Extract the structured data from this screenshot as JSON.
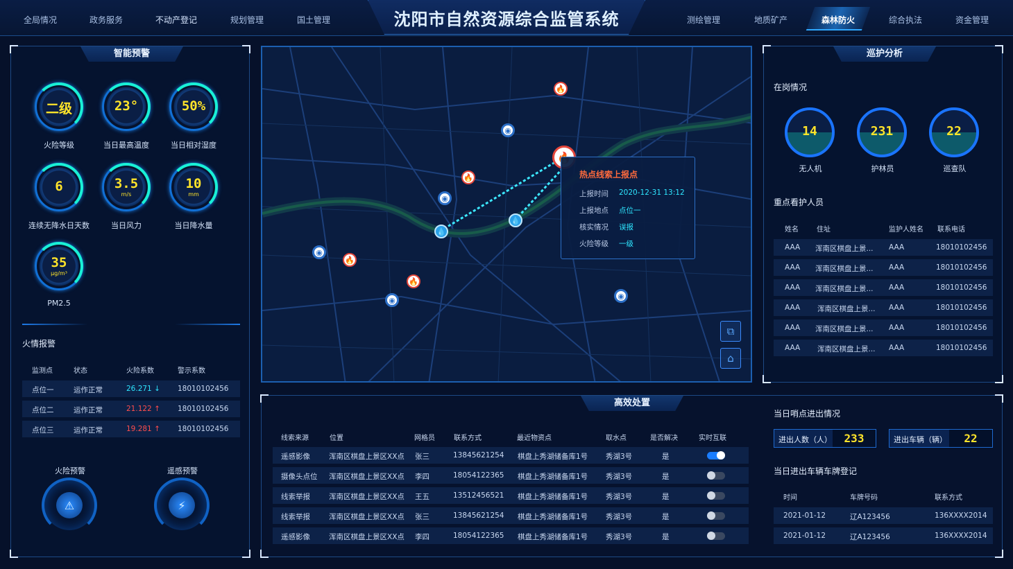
{
  "header": {
    "title": "沈阳市自然资源综合监管系统",
    "nav_left": [
      "全局情况",
      "政务服务",
      "不动产登记",
      "规划管理",
      "国土管理"
    ],
    "nav_right": [
      "测绘管理",
      "地质矿产",
      "森林防火",
      "综合执法",
      "资金管理"
    ],
    "active_nav": "森林防火"
  },
  "smart_warning": {
    "title": "智能预警",
    "gauges": [
      {
        "value": "二级",
        "unit": "",
        "label": "火险等级"
      },
      {
        "value": "23°",
        "unit": "",
        "label": "当日最高温度"
      },
      {
        "value": "50%",
        "unit": "",
        "label": "当日相对湿度"
      },
      {
        "value": "6",
        "unit": "",
        "label": "连续无降水日天数"
      },
      {
        "value": "3.5",
        "unit": "m/s",
        "label": "当日风力"
      },
      {
        "value": "10",
        "unit": "mm",
        "label": "当日降水量"
      },
      {
        "value": "35",
        "unit": "μg/m³",
        "label": "PM2.5"
      }
    ]
  },
  "fire_alarm": {
    "title": "火情报警",
    "headers": [
      "监测点",
      "状态",
      "火险系数",
      "警示系数"
    ],
    "rows": [
      {
        "point": "点位一",
        "status": "运作正常",
        "coef": "26.271 ↓",
        "warn": "18010102456",
        "color": "cyan"
      },
      {
        "point": "点位二",
        "status": "运作正常",
        "coef": "21.122 ↑",
        "warn": "18010102456",
        "color": "red"
      },
      {
        "point": "点位三",
        "status": "运作正常",
        "coef": "19.281 ↑",
        "warn": "18010102456",
        "color": "red"
      }
    ],
    "fire_warning_label": "火险预警",
    "remote_warning_label": "遥感预警"
  },
  "map": {
    "popup": {
      "title": "热点线索上报点",
      "time_label": "上报时间",
      "time": "2020-12-31 13:12",
      "location_label": "上报地点",
      "location": "点位一",
      "verify_label": "核实情况",
      "verify": "误报",
      "level_label": "火险等级",
      "level": "一级"
    }
  },
  "patrol": {
    "title": "巡护分析",
    "on_duty_title": "在岗情况",
    "on_duty": [
      {
        "value": "14",
        "label": "无人机"
      },
      {
        "value": "231",
        "label": "护林员"
      },
      {
        "value": "22",
        "label": "巡查队"
      }
    ],
    "key_persons_title": "重点看护人员",
    "headers": [
      "姓名",
      "住址",
      "监护人姓名",
      "联系电话"
    ],
    "rows": [
      {
        "name": "AAA",
        "addr": "浑南区棋盘上景...",
        "guardian": "AAA",
        "phone": "18010102456"
      },
      {
        "name": "AAA",
        "addr": "浑南区棋盘上景...",
        "guardian": "AAA",
        "phone": "18010102456"
      },
      {
        "name": "AAA",
        "addr": "浑南区棋盘上景...",
        "guardian": "AAA",
        "phone": "18010102456"
      },
      {
        "name": "AAA",
        "addr": "浑南区棋盘上景...",
        "guardian": "AAA",
        "phone": "18010102456"
      },
      {
        "name": "AAA",
        "addr": "浑南区棋盘上景...",
        "guardian": "AAA",
        "phone": "18010102456"
      },
      {
        "name": "AAA",
        "addr": "浑南区棋盘上景...",
        "guardian": "AAA",
        "phone": "18010102456"
      }
    ]
  },
  "disposal": {
    "title": "高效处置",
    "headers": [
      "线索来源",
      "位置",
      "网格员",
      "联系方式",
      "最近物资点",
      "取水点",
      "是否解决",
      "实时互联"
    ],
    "rows": [
      {
        "source": "遥感影像",
        "pos": "浑南区棋盘上景区XX点",
        "member": "张三",
        "contact": "13845621254",
        "depot": "棋盘上秀湖储备库1号",
        "water": "秀湖3号",
        "solved": "是",
        "on": true
      },
      {
        "source": "摄像头点位",
        "pos": "浑南区棋盘上景区XX点",
        "member": "李四",
        "contact": "18054122365",
        "depot": "棋盘上秀湖储备库1号",
        "water": "秀湖3号",
        "solved": "是",
        "on": false
      },
      {
        "source": "线索举报",
        "pos": "浑南区棋盘上景区XX点",
        "member": "王五",
        "contact": "13512456521",
        "depot": "棋盘上秀湖储备库1号",
        "water": "秀湖3号",
        "solved": "是",
        "on": false
      },
      {
        "source": "线索举报",
        "pos": "浑南区棋盘上景区XX点",
        "member": "张三",
        "contact": "13845621254",
        "depot": "棋盘上秀湖储备库1号",
        "water": "秀湖3号",
        "solved": "是",
        "on": false
      },
      {
        "source": "遥感影像",
        "pos": "浑南区棋盘上景区XX点",
        "member": "李四",
        "contact": "18054122365",
        "depot": "棋盘上秀湖储备库1号",
        "water": "秀湖3号",
        "solved": "是",
        "on": false
      }
    ]
  },
  "checkpoint": {
    "title": "当日哨点进出情况",
    "people_label": "进出人数（人）",
    "people": "233",
    "vehicle_label": "进出车辆（辆）",
    "vehicle": "22",
    "plates_title": "当日进出车辆车牌登记",
    "headers": [
      "时间",
      "车牌号码",
      "联系方式"
    ],
    "rows": [
      {
        "time": "2021-01-12",
        "plate": "辽A123456",
        "contact": "136XXXX2014"
      },
      {
        "time": "2021-01-12",
        "plate": "辽A123456",
        "contact": "136XXXX2014"
      }
    ]
  },
  "colors": {
    "accent": "#2ee6ff",
    "gauge_value": "#ffe42a",
    "alert": "#ff4e4e",
    "panel_border": "#1d4a86"
  }
}
